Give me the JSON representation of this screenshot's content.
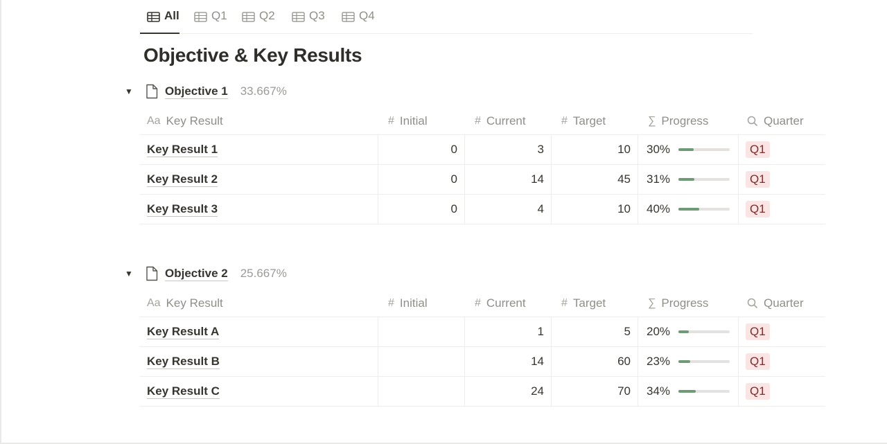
{
  "tabs": [
    {
      "label": "All",
      "icon": "table-icon",
      "active": true
    },
    {
      "label": "Q1",
      "icon": "table-icon",
      "active": false
    },
    {
      "label": "Q2",
      "icon": "table-icon",
      "active": false
    },
    {
      "label": "Q3",
      "icon": "table-icon",
      "active": false
    },
    {
      "label": "Q4",
      "icon": "table-icon",
      "active": false
    }
  ],
  "page_title": "Objective & Key Results",
  "columns": {
    "name": {
      "icon_text": "Aa",
      "label": "Key Result"
    },
    "initial": {
      "icon_text": "#",
      "label": "Initial"
    },
    "current": {
      "icon_text": "#",
      "label": "Current"
    },
    "target": {
      "icon_text": "#",
      "label": "Target"
    },
    "progress": {
      "icon_text": "∑",
      "label": "Progress"
    },
    "quarter": {
      "icon": "search-icon",
      "label": "Quarter"
    }
  },
  "colors": {
    "progress_fill": "#6f9a76",
    "badge_bg": "#fbe4e4",
    "badge_text": "#7a2d2d"
  },
  "groups": [
    {
      "name": "Objective 1",
      "progress": "33.667%",
      "rows": [
        {
          "name": "Key Result 1",
          "initial": "0",
          "current": "3",
          "target": "10",
          "progress": "30%",
          "progress_value": 0.3,
          "quarter": "Q1"
        },
        {
          "name": "Key Result 2",
          "initial": "0",
          "current": "14",
          "target": "45",
          "progress": "31%",
          "progress_value": 0.31,
          "quarter": "Q1"
        },
        {
          "name": "Key Result 3",
          "initial": "0",
          "current": "4",
          "target": "10",
          "progress": "40%",
          "progress_value": 0.4,
          "quarter": "Q1"
        }
      ]
    },
    {
      "name": "Objective 2",
      "progress": "25.667%",
      "rows": [
        {
          "name": "Key Result A",
          "initial": "",
          "current": "1",
          "target": "5",
          "progress": "20%",
          "progress_value": 0.2,
          "quarter": "Q1"
        },
        {
          "name": "Key Result B",
          "initial": "",
          "current": "14",
          "target": "60",
          "progress": "23%",
          "progress_value": 0.23,
          "quarter": "Q1"
        },
        {
          "name": "Key Result C",
          "initial": "",
          "current": "24",
          "target": "70",
          "progress": "34%",
          "progress_value": 0.34,
          "quarter": "Q1"
        }
      ]
    }
  ]
}
